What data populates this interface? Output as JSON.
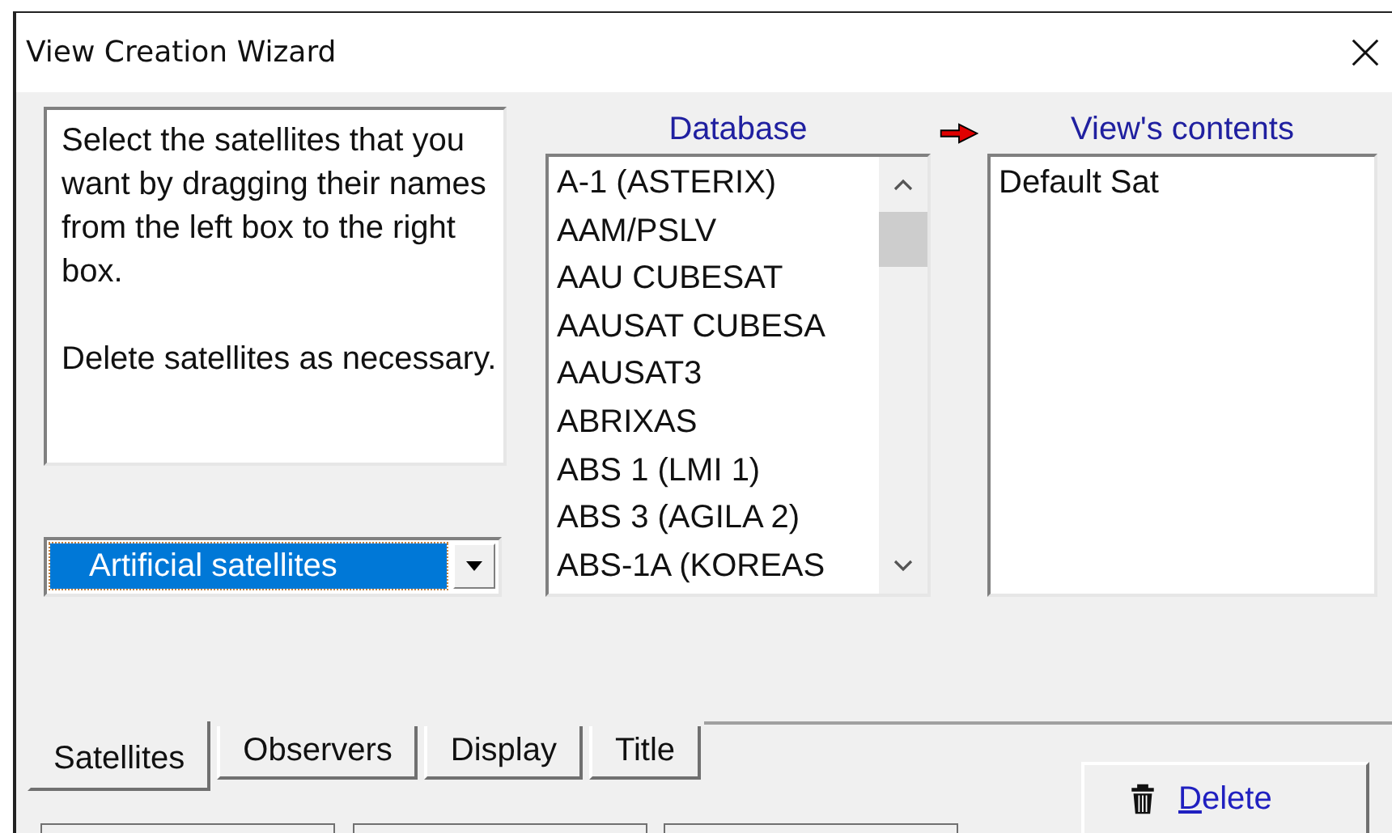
{
  "window": {
    "title": "View Creation Wizard"
  },
  "instructions": [
    "Select the satellites that you want by dragging their names from the left box to the right box.",
    "Delete satellites as necessary."
  ],
  "category_dropdown": {
    "value": "Artificial satellites"
  },
  "database": {
    "label": "Database",
    "items": [
      {
        "name": "A-1 (ASTERIX)",
        "selected": false
      },
      {
        "name": "AAM/PSLV",
        "selected": false
      },
      {
        "name": "AAU CUBESAT",
        "selected": false
      },
      {
        "name": "AAUSAT CUBESA",
        "selected": false
      },
      {
        "name": "AAUSAT3",
        "selected": false
      },
      {
        "name": "ABRIXAS",
        "selected": false
      },
      {
        "name": "ABS 1 (LMI 1)",
        "selected": false
      },
      {
        "name": "ABS 3 (AGILA 2)",
        "selected": false
      },
      {
        "name": "ABS-1A (KOREAS",
        "selected": false
      }
    ]
  },
  "view_contents": {
    "label": "View's contents",
    "items": [
      {
        "name": "Default Sat",
        "selected": false
      }
    ]
  },
  "tabs": [
    {
      "label": "Satellites",
      "selected": true
    },
    {
      "label": "Observers",
      "selected": false
    },
    {
      "label": "Display",
      "selected": false
    },
    {
      "label": "Title",
      "selected": false
    }
  ],
  "delete_button": {
    "label": "Delete"
  }
}
